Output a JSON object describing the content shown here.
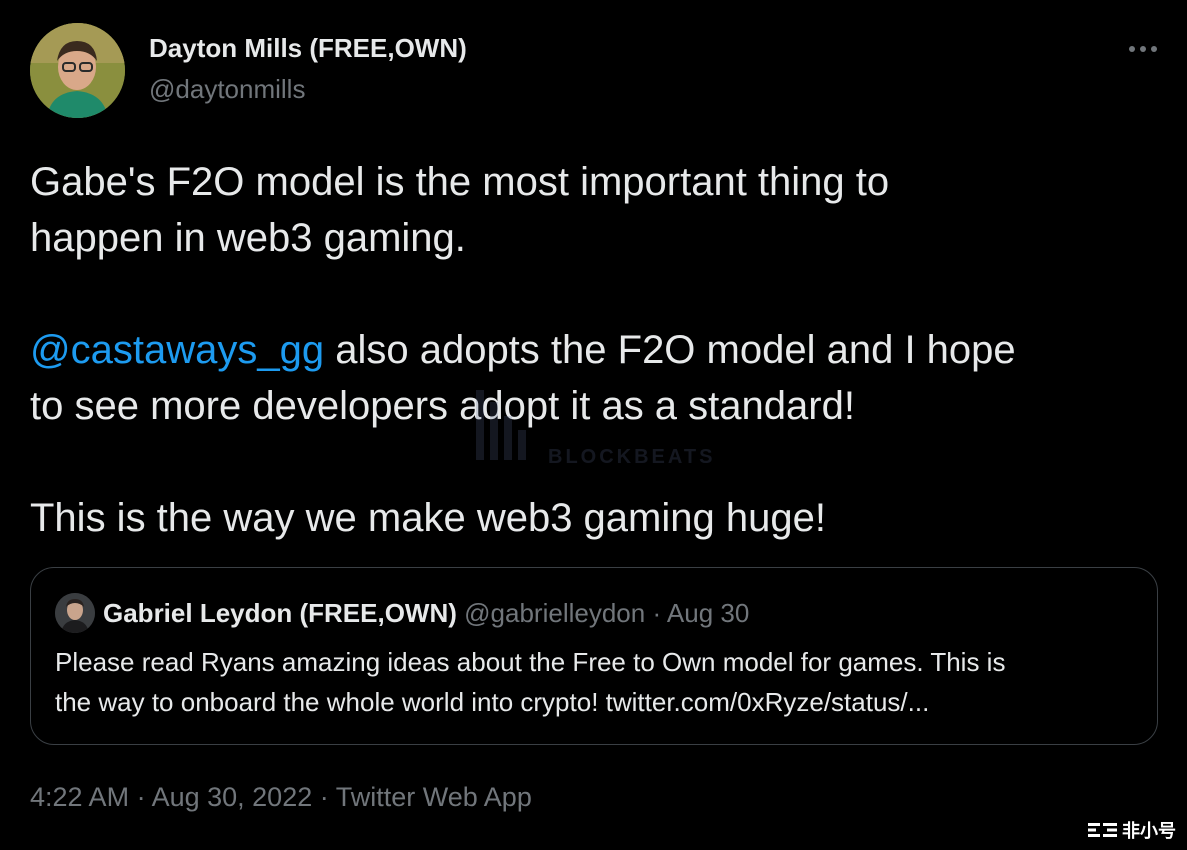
{
  "author": {
    "display_name": "Dayton Mills (FREE,OWN)",
    "handle": "@daytonmills"
  },
  "more_icon": "more-horizontal-icon",
  "tweet": {
    "line1": "Gabe's F2O model is the most important thing to",
    "line2": "happen in web3 gaming.",
    "mention": "@castaways_gg",
    "line3_rest": " also adopts the F2O model and I hope",
    "line4": "to see more developers adopt it as a standard!",
    "line5": "This is the way we make web3 gaming huge!"
  },
  "quote": {
    "display_name": "Gabriel Leydon (FREE,OWN)",
    "handle": "@gabrielleydon",
    "separator": " · ",
    "date": "Aug 30",
    "line1": "Please read Ryans amazing ideas about the Free to Own model for games. This is",
    "line2": "the way to onboard the whole world into crypto! twitter.com/0xRyze/status/..."
  },
  "footer": {
    "time": "4:22 AM",
    "separator": " · ",
    "date": "Aug 30, 2022",
    "source": "Twitter Web App"
  },
  "watermark": {
    "text": "BLOCKBEATS"
  },
  "corner_logo": {
    "text": "非小号"
  },
  "colors": {
    "background": "#000000",
    "text": "#e7e9ea",
    "muted": "#71767b",
    "link": "#1d9bf0",
    "border": "#3a3f44"
  }
}
